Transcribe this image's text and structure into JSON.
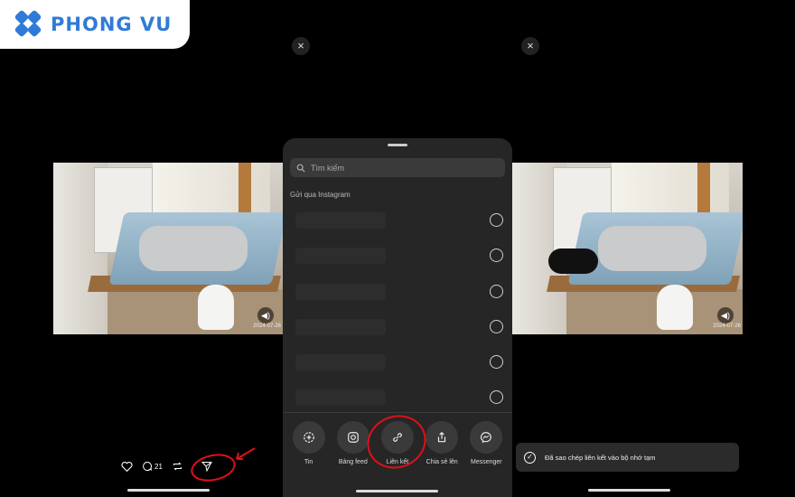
{
  "brand": {
    "name": "PHONG VU"
  },
  "colors": {
    "accent": "#2f7bd8",
    "annotation": "#e0101a"
  },
  "close_icon": "×",
  "video": {
    "timestamp": "2024-07-26"
  },
  "post_actions": {
    "comment_count": "21"
  },
  "share_sheet": {
    "search_placeholder": "Tìm kiếm",
    "section_label": "Gửi qua Instagram",
    "contact_count": 6,
    "actions": [
      {
        "label": "Tin",
        "icon": "add-story-icon"
      },
      {
        "label": "Bảng feed",
        "icon": "instagram-icon"
      },
      {
        "label": "Liên kết",
        "icon": "link-icon"
      },
      {
        "label": "Chia sẻ lên",
        "icon": "share-icon"
      },
      {
        "label": "Messenger",
        "icon": "messenger-icon"
      }
    ]
  },
  "toast": {
    "text": "Đã sao chép liên kết vào bộ nhớ tạm"
  }
}
